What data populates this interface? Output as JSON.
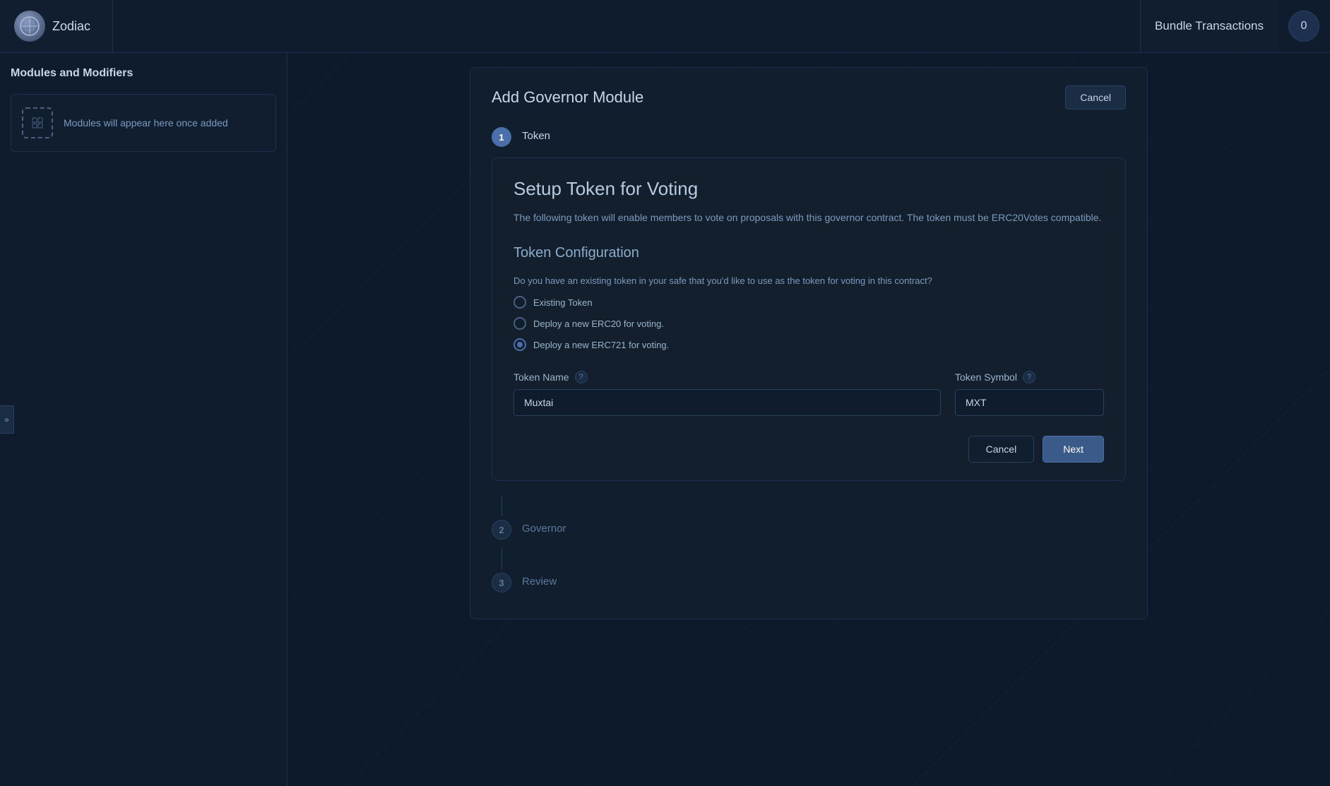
{
  "header": {
    "logo_text": "Zodiac",
    "bundle_label": "Bundle Transactions",
    "bundle_count": "0"
  },
  "sidebar": {
    "title": "Modules and Modifiers",
    "empty_text": "Modules will appear here once added",
    "toggle_icon": "»"
  },
  "panel": {
    "title": "Add Governor Module",
    "cancel_top_label": "Cancel",
    "steps": [
      {
        "number": "1",
        "label": "Token",
        "active": true
      },
      {
        "number": "2",
        "label": "Governor",
        "active": false
      },
      {
        "number": "3",
        "label": "Review",
        "active": false
      }
    ],
    "token_setup": {
      "title": "Setup Token for Voting",
      "description": "The following token will enable members to vote on proposals with this governor contract. The token must be ERC20Votes compatible.",
      "config_title": "Token Configuration",
      "radio_question": "Do you have an existing token in your safe that you'd like to use as the token for voting in this contract?",
      "radio_options": [
        {
          "id": "existing",
          "label": "Existing Token",
          "selected": false
        },
        {
          "id": "erc20",
          "label": "Deploy a new ERC20 for voting.",
          "selected": false
        },
        {
          "id": "erc721",
          "label": "Deploy a new ERC721 for voting.",
          "selected": true
        }
      ],
      "token_name_label": "Token Name",
      "token_name_value": "Muxtai",
      "token_name_placeholder": "Token Name",
      "token_symbol_label": "Token Symbol",
      "token_symbol_value": "MXT",
      "token_symbol_placeholder": "Token Symbol",
      "cancel_label": "Cancel",
      "next_label": "Next"
    }
  }
}
